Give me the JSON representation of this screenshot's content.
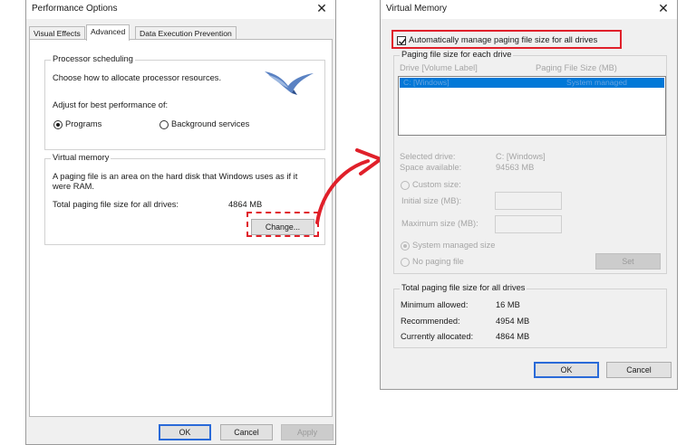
{
  "perf": {
    "title": "Performance Options",
    "tabs": [
      "Visual Effects",
      "Advanced",
      "Data Execution Prevention"
    ],
    "processor": {
      "group_label": "Processor scheduling",
      "desc": "Choose how to allocate processor resources.",
      "adjust": "Adjust for best performance of:",
      "programs": "Programs",
      "background": "Background services"
    },
    "vm": {
      "group_label": "Virtual memory",
      "desc_line1": "A paging file is an area on the hard disk that Windows uses as if it",
      "desc_line2": "were RAM.",
      "total_label": "Total paging file size for all drives:",
      "total_value": "4864 MB",
      "change": "Change..."
    },
    "footer": {
      "ok": "OK",
      "cancel": "Cancel",
      "apply": "Apply"
    }
  },
  "vmdlg": {
    "title": "Virtual Memory",
    "auto_label": "Automatically manage paging file size for all drives",
    "each_label": "Paging file size for each drive",
    "col_drive": "Drive  [Volume Label]",
    "col_size": "Paging File Size (MB)",
    "row_drive": "C:       [Windows]",
    "row_size": "System managed",
    "selected_label": "Selected drive:",
    "selected_value": "C:  [Windows]",
    "space_label": "Space available:",
    "space_value": "94563 MB",
    "custom": "Custom size:",
    "initial": "Initial size (MB):",
    "maximum": "Maximum size (MB):",
    "system_managed": "System managed size",
    "no_paging": "No paging file",
    "set": "Set",
    "total_group": "Total paging file size for all drives",
    "min_label": "Minimum allowed:",
    "min_value": "16 MB",
    "rec_label": "Recommended:",
    "rec_value": "4954 MB",
    "cur_label": "Currently allocated:",
    "cur_value": "4864 MB",
    "ok": "OK",
    "cancel": "Cancel"
  },
  "colors": {
    "highlight": "#e0202a",
    "selection": "#0078d7",
    "focus": "#2a6ad8"
  }
}
